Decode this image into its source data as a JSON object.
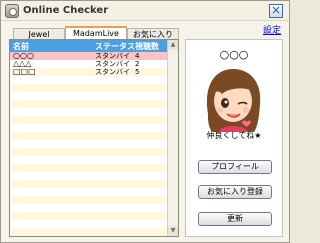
{
  "window": {
    "title": "Online Checker",
    "settings_label": "設定",
    "close_label": "×"
  },
  "tabs": [
    {
      "label": "Jewel",
      "active": false
    },
    {
      "label": "MadamLive",
      "active": true
    },
    {
      "label": "お気に入り",
      "active": false
    }
  ],
  "list": {
    "headers": {
      "name": "名前",
      "status": "ステータス",
      "count": "視聴数"
    },
    "rows": [
      {
        "name": "○○○",
        "status": "スタンバイ",
        "count": "4",
        "selected": true
      },
      {
        "name": "△△△",
        "status": "スタンバイ",
        "count": "2",
        "selected": false
      },
      {
        "name": "□□□",
        "status": "スタンバイ",
        "count": "5",
        "selected": false
      }
    ]
  },
  "profile": {
    "name": "○○○",
    "caption": "仲良くしてね★",
    "buttons": {
      "profile": "プロフィール",
      "favorite": "お気に入り登録",
      "refresh": "更新"
    }
  },
  "colors": {
    "header_bg": "#4d9fe1",
    "selected_row": "#f8c4c4",
    "alt_row": "#fff7e0",
    "active_tab_accent": "#f0a040"
  }
}
